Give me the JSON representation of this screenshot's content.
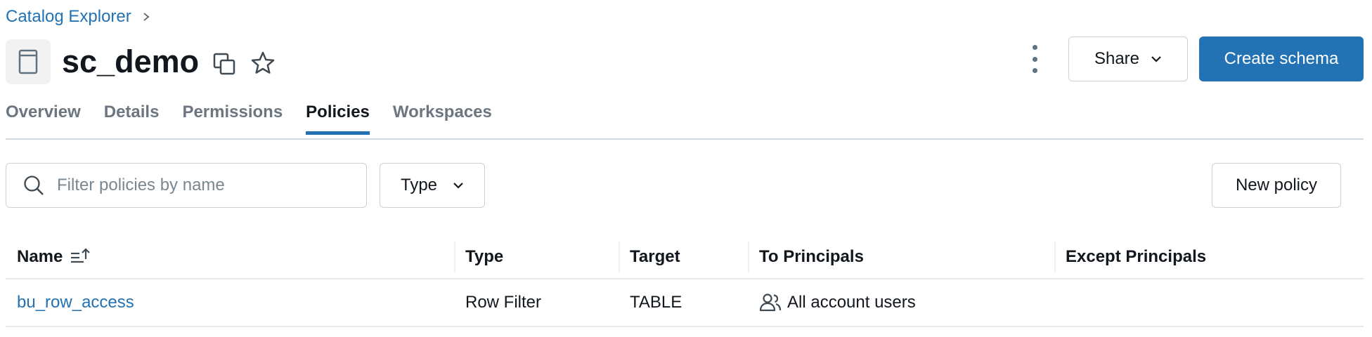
{
  "breadcrumb": {
    "label": "Catalog Explorer"
  },
  "header": {
    "title": "sc_demo",
    "share_label": "Share",
    "create_label": "Create schema"
  },
  "tabs": [
    {
      "label": "Overview",
      "active": false
    },
    {
      "label": "Details",
      "active": false
    },
    {
      "label": "Permissions",
      "active": false
    },
    {
      "label": "Policies",
      "active": true
    },
    {
      "label": "Workspaces",
      "active": false
    }
  ],
  "filters": {
    "search_placeholder": "Filter policies by name",
    "type_label": "Type",
    "new_policy_label": "New policy"
  },
  "table": {
    "columns": [
      "Name",
      "Type",
      "Target",
      "To Principals",
      "Except Principals"
    ],
    "rows": [
      {
        "name": "bu_row_access",
        "type": "Row Filter",
        "target": "TABLE",
        "to_principals": "All account users",
        "except_principals": ""
      }
    ]
  },
  "colors": {
    "accent": "#2272b4",
    "text": "#11171c",
    "muted": "#6b7680",
    "border": "#cbd2d9"
  },
  "icons": [
    "chevron-right-icon",
    "schema-icon",
    "copy-icon",
    "star-icon",
    "kebab-menu-icon",
    "chevron-down-icon",
    "search-icon",
    "sort-ascending-icon",
    "users-icon"
  ]
}
